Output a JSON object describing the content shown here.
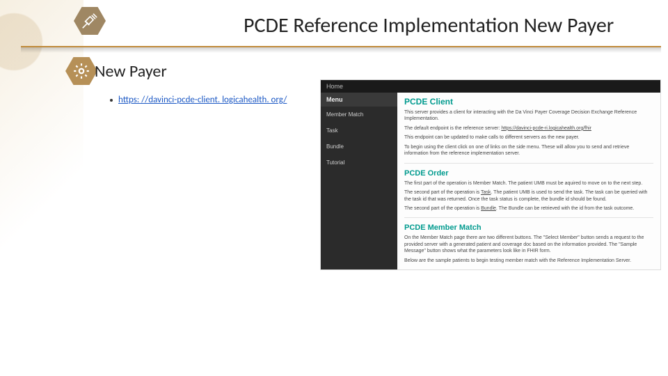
{
  "slide": {
    "title": "PCDE Reference Implementation New Payer",
    "section_heading": "New Payer",
    "bullet_link_text": "https: //davinci-pcde-client. logicahealth. org/"
  },
  "app": {
    "topbar_home": "Home",
    "menu_header": "Menu",
    "menu_items": [
      "Member Match",
      "Task",
      "Bundle",
      "Tutorial"
    ],
    "client": {
      "title": "PCDE Client",
      "p1": "This server provides a client for interacting with the Da Vinci Payer Coverage Decision Exchange Reference Implementation.",
      "p2_prefix": "The default endpoint is the reference server: ",
      "p2_link": "https://davinci-pcde-ri.logicahealth.org/fhir",
      "p3": "This endpoint can be updated to make calls to different servers as the new payer.",
      "p4": "To begin using the client click on one of links on the side menu. These will allow you to send and retrieve information from the reference implementation server."
    },
    "order": {
      "title": "PCDE Order",
      "p1": "The first part of the operation is Member Match. The patient UMB must be aquired to move on to the next step.",
      "p2_prefix": "The second part of the operation is ",
      "p2_link": "Task",
      "p2_suffix": ". The patient UMB is used to send the task. The task can be queried with the task id that was returned. Once the task status is complete, the bundle id should be found.",
      "p3_prefix": "The second part of the operation is ",
      "p3_link": "Bundle",
      "p3_suffix": ". The Bundle can be retrieved with the id from the task outcome."
    },
    "match": {
      "title": "PCDE Member Match",
      "p1": "On the Member Match page there are two different buttons. The \"Select Member\" button sends a request to the provided server with a generated patient and coverage doc based on the information provided. The \"Sample Message\" button shows what the parameters look like in FHIR form.",
      "p2": "Below are the sample patients to begin testing member match with the Reference Implementation Server."
    }
  }
}
